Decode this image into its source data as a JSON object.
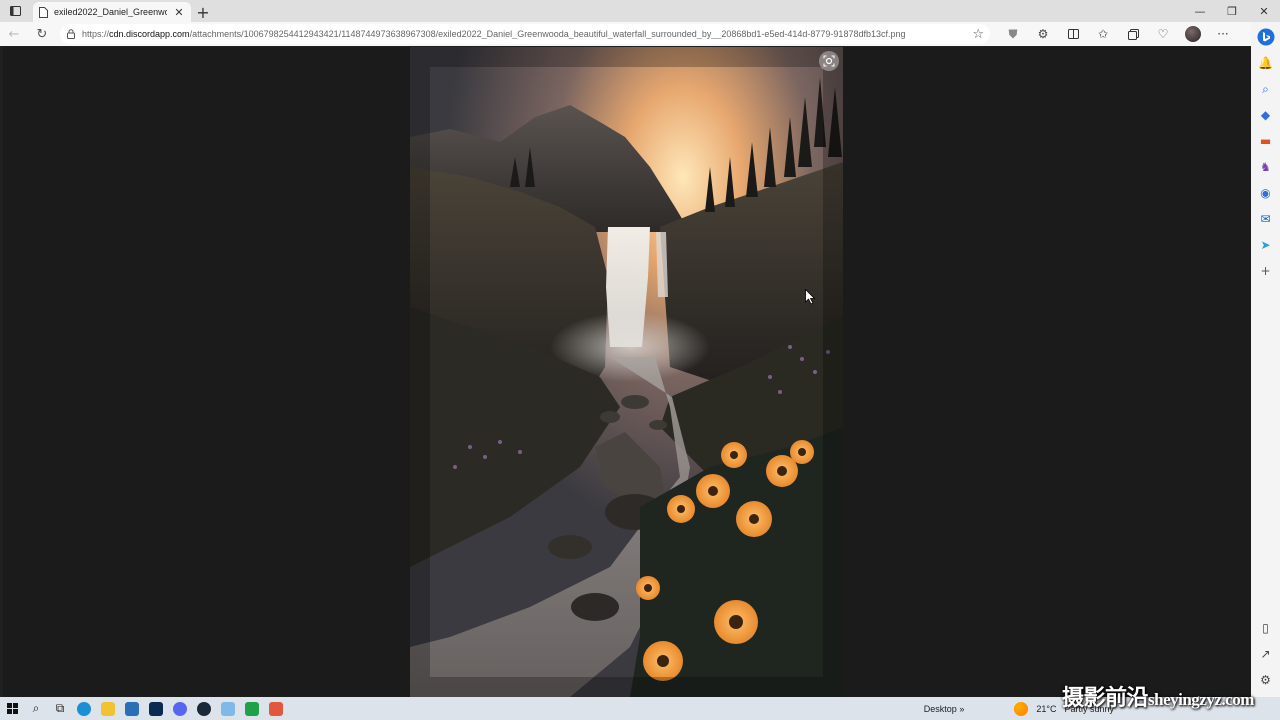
{
  "browser": {
    "tab": {
      "title": "exiled2022_Daniel_Greenwooda_beautiful_waterfall_surrounded_by__20868bd1-e5ed-414d-8779-91878dfb13cf.png"
    },
    "address": {
      "scheme": "https://",
      "host": "cdn.discordapp.com",
      "path": "/attachments/1006798254412943421/1148744973638967308/exiled2022_Daniel_Greenwooda_beautiful_waterfall_surrounded_by__20868bd1-e5ed-414d-8779-91878dfb13cf.png"
    },
    "icons": {
      "tab_actions": "tab-actions-icon",
      "favicon": "page-icon",
      "close_tab": "close-icon",
      "new_tab": "plus-icon",
      "back": "back-arrow-icon",
      "refresh": "refresh-icon",
      "site_info": "info-icon",
      "favorite": "star-icon",
      "shield": "shield-icon",
      "extensions": "puzzle-icon",
      "split_screen": "split-icon",
      "favorites_bar": "favorites-icon",
      "collections": "collections-icon",
      "performance": "heart-pulse-icon",
      "profile": "avatar",
      "menu": "more-icon",
      "copilot": "bing-icon"
    }
  },
  "content": {
    "image": "waterfall-landscape-photo",
    "visual_search": "visual-search-icon"
  },
  "sidebar": {
    "items": [
      "bell-icon",
      "search-icon",
      "shopping-tag-icon",
      "tools-icon",
      "games-icon",
      "microsoft365-icon",
      "outlook-icon",
      "send-icon",
      "add-icon"
    ],
    "bottom": [
      "sidebar-toggle-icon",
      "open-external-icon",
      "settings-icon"
    ]
  },
  "taskbar": {
    "apps": [
      "edge",
      "file-explorer",
      "store",
      "photoshop",
      "discord",
      "steam",
      "notepad",
      "app-green",
      "app-red"
    ],
    "desktop_label": "Desktop",
    "weather": {
      "temp": "21°C",
      "condition": "Partly sunny"
    },
    "colors": {
      "edge": "#1a8fd6",
      "explorer": "#f1c232",
      "store": "#2a6fb5",
      "photoshop": "#0a2a52",
      "discord": "#5865f2",
      "steam": "#1b2838",
      "notepad": "#7fb9e6",
      "green": "#21a04a",
      "red": "#e2583e"
    }
  },
  "watermark": {
    "cn": "摄影前沿",
    "latin": "sheyingzyz.com"
  }
}
